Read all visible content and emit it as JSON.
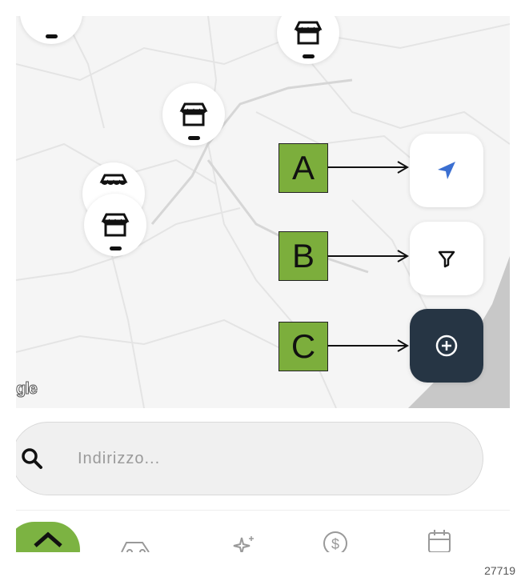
{
  "map": {
    "attribution": "gle",
    "markers": [
      {
        "icon": "store-icon"
      },
      {
        "icon": "store-icon"
      },
      {
        "icon": "store-icon"
      },
      {
        "icon": "store-icon"
      },
      {
        "icon": "store-icon"
      }
    ]
  },
  "controls": {
    "locate_icon": "navigation-arrow-icon",
    "filter_icon": "filter-icon",
    "add_icon": "add-circle-icon",
    "locate_color": "#3b6fd1",
    "add_bg": "#263544"
  },
  "annotations": {
    "a": "A",
    "b": "B",
    "c": "C",
    "label_color": "#7cae3c"
  },
  "search": {
    "placeholder": "Indirizzo..."
  },
  "tabs": [
    {
      "icon": "home-icon",
      "active": true
    },
    {
      "icon": "car-icon"
    },
    {
      "icon": "sparkle-icon"
    },
    {
      "icon": "dollar-icon"
    },
    {
      "icon": "calendar-icon"
    }
  ],
  "accent": "#7cb342",
  "footer": {
    "id": "27719"
  }
}
